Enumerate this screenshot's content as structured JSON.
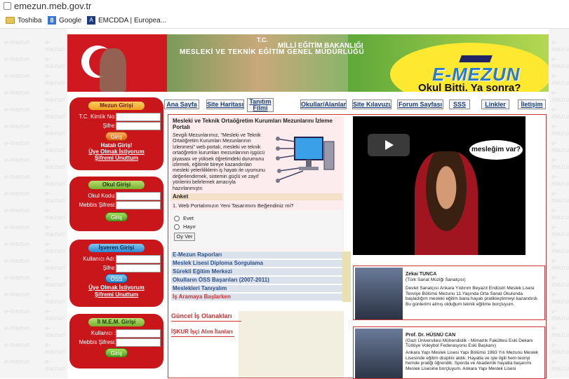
{
  "browser": {
    "url": "emezun.meb.gov.tr",
    "bookmarks": [
      {
        "icon": "folder-icon",
        "label": "Toshiba"
      },
      {
        "icon": "google-icon",
        "label": "Google"
      },
      {
        "icon": "emcdda-icon",
        "label": "EMCDDA | Europea..."
      }
    ]
  },
  "watermark": "e-mezun",
  "banner": {
    "line1": "T.C.",
    "line2": "MİLLİ EĞİTİM BAKANLIĞI",
    "line3": "MESLEKİ VE TEKNİK EĞİTİM GENEL MÜDÜRLÜĞÜ",
    "logo": "E-MEZUN",
    "slogan": "Okul Bitti. Ya sonra?"
  },
  "nav": [
    "Ana Sayfa",
    "Site Haritası",
    "Tanıtım Filmi",
    "Okullar/Alanlar",
    "Site Kılavuzu",
    "Forum Sayfası",
    "SSS",
    "Linkler",
    "İletişim"
  ],
  "login": {
    "mezun": {
      "title": "Mezun Girişi",
      "f1": "T.C. Kimlik No:",
      "f2": "Şifre:",
      "btn": "Giriş",
      "err": "Hatalı Giriş!",
      "l1": "Üye Olmak İstiyorum",
      "l2": "Şifremi Unuttum"
    },
    "okul": {
      "title": "Okul Girişi",
      "f1": "Okul Kodu:",
      "f2": "Mebbis Şifresi:",
      "btn": "Giriş"
    },
    "isveren": {
      "title": "İşveren Girişi",
      "f1": "Kullanıcı Adı:",
      "f2": "Şifre:",
      "btn": "ÖSS",
      "l1": "Üye Olmak İstiyorum",
      "l2": "Şifremi Unuttum"
    },
    "mem": {
      "title": "İl M.E.M. Girişi",
      "f1": "Kullanıcı :",
      "f2": "Mebbis Şifresi:",
      "btn": "Giriş"
    }
  },
  "intro": {
    "heading": "Mesleki ve Teknik Ortaöğretim Kurumları Mezunlarını İzleme Portalı",
    "text": "Sevgili Mezunlarımız, \"Mesleki ve Teknik Ortaöğretim Kurumları Mezunlarının İzlenmesi\" web portalı, mesleki ve teknik ortaöğretim kurumları mezunlarının işgücü piyasası ve yüksek öğretimdeki durumunu izlemek, eğitimle bireye kazandırılan mesleki yeterliliklerin iş hayatı ile uyumunu değerlendirmek, sistemin güçlü ve zayıf yönlerini belirlemek amacıyla hazırlanmıştır."
  },
  "poll": {
    "title": "Anket",
    "question": "1. Web Portalımızın Yeni Tasarımını Beğendiniz mi?",
    "options": [
      "Evet",
      "Hayır"
    ],
    "button": "Oy Ver"
  },
  "video": {
    "bubble": "mesleğim var?"
  },
  "links": [
    "E-Mezun Raporları",
    "Meslek Lisesi Diploma Sorgulama",
    "Sürekli Eğitim Merkezi",
    "Okulların ÖSS Başarıları (2007-2011)",
    "Meslekleri Tanıyalım",
    "İş Aramaya Başlarken"
  ],
  "jobs": {
    "title": "Güncel İş Olanakları",
    "link": "İŞKUR İşçi Alım İlanları"
  },
  "profiles": [
    {
      "name": "Zekai TUNCA",
      "sub": "(Türk Sanat Müziği Sanatçısı)",
      "text": "Devlet Sanatçısı Ankara Yıldırım Beyazıt Endüstri Meslek Lisesi Tesviye Bölümü Mezunu 11.Yaşında Orta Sanat Okulunda başladığım mesleki eğitim bana hayatı pratikleştirmeyi kazandırdı. Bu günlerimi almış olduğum teknik eğitime borçluyum."
    },
    {
      "name": "Prof. Dr. HÜSNÜ CAN",
      "sub": "(Gazi Üniversitesi Mühendislik - Mimarlık Fakültesi Eski Dekanı Türkiye Voleybol Federasyonu Eski Başkanı)",
      "text": "Ankara Yapı Meslek Lisesi Yapı Bölümü 1963 Yılı Mezunu Meslek Lisesinde eğitim disiplini aldık. Hayatla ve işle ilgili hem teoriyi hemde pratiği öğrendik. Sporda ve Akademik hayatta başarımı Meslek Lisesine borçluyum. Ankara Yapı Meslek Lisesi"
    }
  ]
}
